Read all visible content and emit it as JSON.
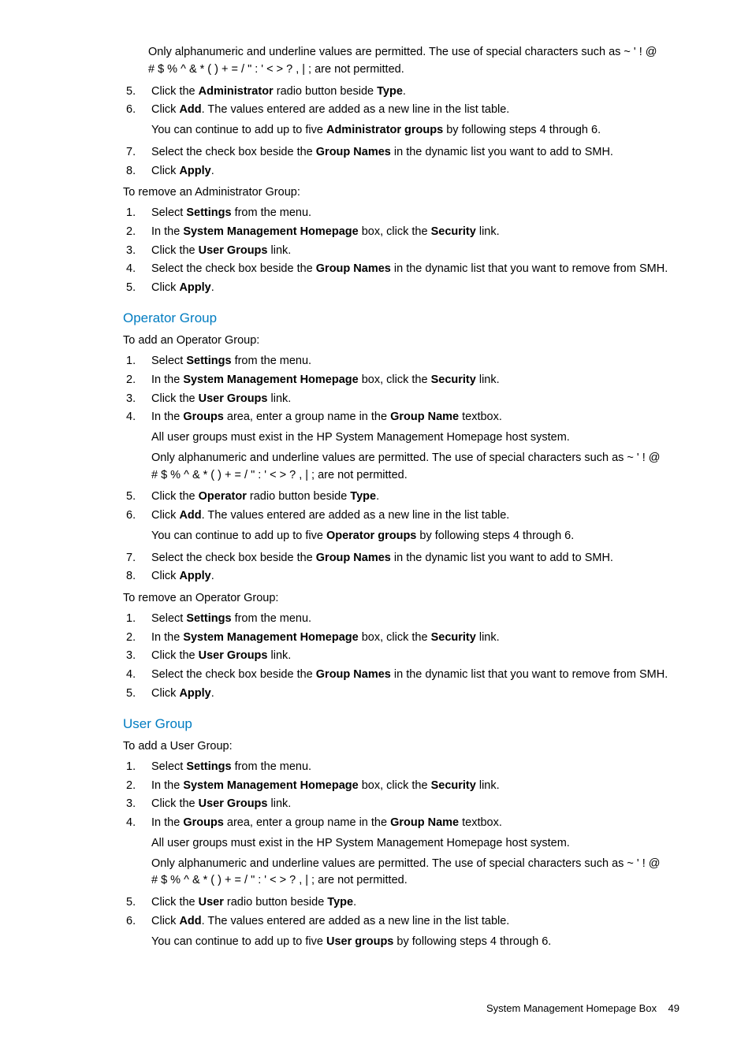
{
  "top_note": {
    "line1_a": "Only alphanumeric and underline values are permitted. The use of special characters such as ~ ' ! @",
    "line2_a": "# $ % ^ & * ( ) + = / \" : ' < > ? , | ; are not permitted."
  },
  "admin_add": {
    "s5_a": "Click the ",
    "s5_b": "Administrator",
    "s5_c": " radio button beside ",
    "s5_d": "Type",
    "s5_e": ".",
    "s6_a": "Click ",
    "s6_b": "Add",
    "s6_c": ". The values entered are added as a new line in the list table.",
    "s6_sub_a": "You can continue to add up to five ",
    "s6_sub_b": "Administrator groups",
    "s6_sub_c": " by following steps 4 through 6.",
    "s7_a": "Select the check box beside the ",
    "s7_b": "Group Names",
    "s7_c": " in the dynamic list you want to add to SMH.",
    "s8_a": "Click ",
    "s8_b": "Apply",
    "s8_c": "."
  },
  "admin_remove_intro": "To remove an Administrator Group:",
  "admin_remove": {
    "s1_a": "Select ",
    "s1_b": "Settings",
    "s1_c": " from the menu.",
    "s2_a": "In the ",
    "s2_b": "System Management Homepage",
    "s2_c": " box, click the ",
    "s2_d": "Security",
    "s2_e": " link.",
    "s3_a": "Click the ",
    "s3_b": "User Groups",
    "s3_c": " link.",
    "s4_a": "Select the check box beside the ",
    "s4_b": "Group Names",
    "s4_c": " in the dynamic list that you want to remove from SMH.",
    "s5_a": "Click ",
    "s5_b": "Apply",
    "s5_c": "."
  },
  "op_heading": "Operator Group",
  "op_add_intro": "To add an Operator Group:",
  "op_add": {
    "s1_a": "Select ",
    "s1_b": "Settings",
    "s1_c": " from the menu.",
    "s2_a": "In the ",
    "s2_b": "System Management Homepage",
    "s2_c": " box, click the ",
    "s2_d": "Security",
    "s2_e": " link.",
    "s3_a": "Click the ",
    "s3_b": "User Groups",
    "s3_c": " link.",
    "s4_a": "In the ",
    "s4_b": "Groups",
    "s4_c": " area, enter a group name in the ",
    "s4_d": "Group Name",
    "s4_e": " textbox.",
    "s4_sub1": "All user groups must exist in the HP System Management Homepage host system.",
    "s4_sub2a": "Only alphanumeric and underline values are permitted. The use of special characters such as ~ ' ! @",
    "s4_sub2b": "# $ % ^ & * ( ) + = / \" : ' < > ? , | ; are not permitted.",
    "s5_a": "Click the ",
    "s5_b": "Operator",
    "s5_c": " radio button beside ",
    "s5_d": "Type",
    "s5_e": ".",
    "s6_a": "Click ",
    "s6_b": "Add",
    "s6_c": ". The values entered are added as a new line in the list table.",
    "s6_sub_a": "You can continue to add up to five ",
    "s6_sub_b": "Operator groups",
    "s6_sub_c": " by following steps 4 through 6.",
    "s7_a": "Select the check box beside the ",
    "s7_b": "Group Names",
    "s7_c": " in the dynamic list you want to add to SMH.",
    "s8_a": "Click ",
    "s8_b": "Apply",
    "s8_c": "."
  },
  "op_remove_intro": "To remove an Operator Group:",
  "op_remove": {
    "s1_a": "Select ",
    "s1_b": "Settings",
    "s1_c": " from the menu.",
    "s2_a": "In the ",
    "s2_b": "System Management Homepage",
    "s2_c": " box, click the ",
    "s2_d": "Security",
    "s2_e": " link.",
    "s3_a": "Click the ",
    "s3_b": "User Groups",
    "s3_c": " link.",
    "s4_a": "Select the check box beside the ",
    "s4_b": "Group Names",
    "s4_c": " in the dynamic list that you want to remove from SMH.",
    "s5_a": "Click ",
    "s5_b": "Apply",
    "s5_c": "."
  },
  "user_heading": "User Group",
  "user_add_intro": "To add a User Group:",
  "user_add": {
    "s1_a": "Select ",
    "s1_b": "Settings",
    "s1_c": " from the menu.",
    "s2_a": "In the ",
    "s2_b": "System Management Homepage",
    "s2_c": " box, click the ",
    "s2_d": "Security",
    "s2_e": " link.",
    "s3_a": "Click the ",
    "s3_b": "User Groups",
    "s3_c": " link.",
    "s4_a": "In the ",
    "s4_b": "Groups",
    "s4_c": " area, enter a group name in the ",
    "s4_d": "Group Name",
    "s4_e": " textbox.",
    "s4_sub1": "All user groups must exist in the HP System Management Homepage host system.",
    "s4_sub2a": "Only alphanumeric and underline values are permitted. The use of special characters such as ~ ' ! @",
    "s4_sub2b": "# $ % ^ & * ( ) + = / \" : ' < > ? , | ; are not permitted.",
    "s5_a": "Click the ",
    "s5_b": "User",
    "s5_c": " radio button beside ",
    "s5_d": "Type",
    "s5_e": ".",
    "s6_a": "Click ",
    "s6_b": "Add",
    "s6_c": ". The values entered are added as a new line in the list table.",
    "s6_sub_a": "You can continue to add up to five ",
    "s6_sub_b": "User groups",
    "s6_sub_c": " by following steps 4 through 6."
  },
  "footer_text": "System Management Homepage Box",
  "footer_page": "49"
}
